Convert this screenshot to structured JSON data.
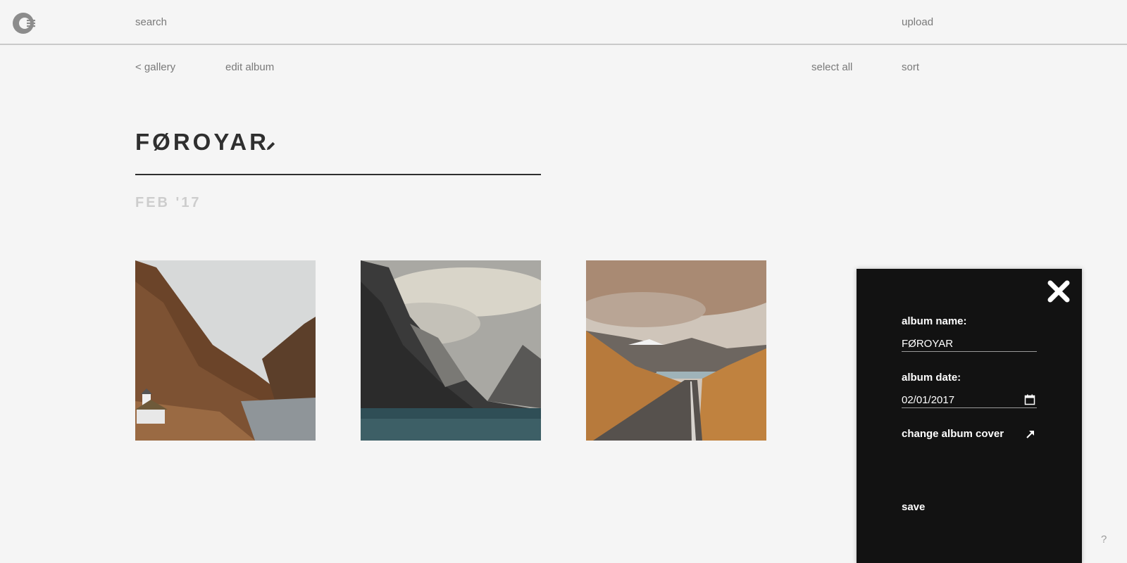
{
  "header": {
    "logo_icon": "logo-icon",
    "search_label": "search",
    "upload_label": "upload"
  },
  "subnav": {
    "back_label": "< gallery",
    "edit_album_label": "edit album",
    "select_all_label": "select all",
    "sort_label": "sort"
  },
  "album": {
    "title": "FØROYAR",
    "edit_icon": "pencil-icon",
    "date": "FEB '17",
    "photos": [
      {
        "subject": "mountain valley with turf-roof house and lake"
      },
      {
        "subject": "misty dark mountains over fjord"
      },
      {
        "subject": "road leading through brown valley to lake"
      }
    ]
  },
  "edit_panel": {
    "close_icon": "close-icon",
    "name_label": "album name:",
    "name_value": "FØROYAR",
    "date_label": "album date:",
    "date_value": "02/01/2017",
    "calendar_icon": "calendar-icon",
    "change_cover_label": "change album cover",
    "change_cover_icon": "arrow-up-right-icon",
    "save_label": "save"
  },
  "help": {
    "label": "?"
  },
  "colors": {
    "background": "#f5f5f5",
    "panel": "#121212",
    "text_dark": "#2f2f2f",
    "text_muted": "#7a7a7a",
    "date_muted": "#cdcdcd"
  }
}
